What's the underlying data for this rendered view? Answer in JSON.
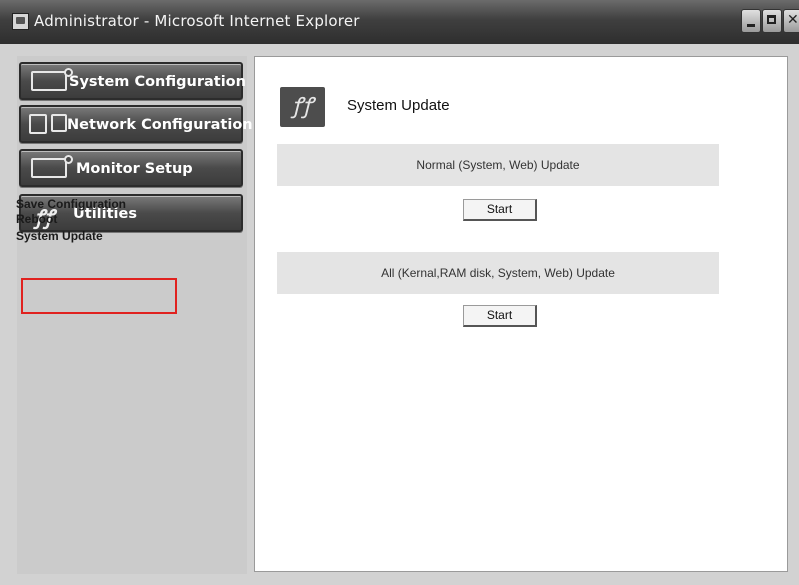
{
  "window": {
    "title": "Administrator - Microsoft Internet Explorer"
  },
  "sidebar": {
    "nav": [
      {
        "label": "System Configuration",
        "icon": "monitor-gear-icon"
      },
      {
        "label": "Network Configuration",
        "icon": "network-computers-icon"
      },
      {
        "label": "Monitor Setup",
        "icon": "monitor-gear-icon"
      },
      {
        "label": "Utilities",
        "icon": "tools-wrench-icon"
      }
    ],
    "submenu": [
      {
        "label": "Save Configuration"
      },
      {
        "label": "Reboot"
      },
      {
        "label": "System Update",
        "highlighted": true
      }
    ]
  },
  "main": {
    "title": "System Update",
    "icon": "tools-wrench-icon",
    "sections": [
      {
        "label": "Normal (System, Web) Update",
        "button": "Start"
      },
      {
        "label": "All (Kernal,RAM disk, System, Web) Update",
        "button": "Start"
      }
    ]
  },
  "colors": {
    "highlight_border": "#e0221f",
    "nav_button": "#4a4a4a",
    "band": "#e4e4e4"
  }
}
